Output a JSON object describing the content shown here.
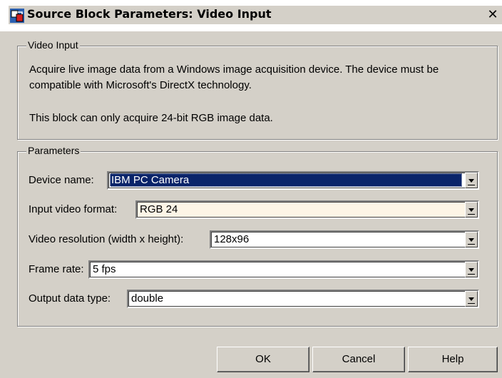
{
  "window": {
    "title": "Source Block Parameters: Video Input",
    "close_glyph": "✕",
    "icon": "simulink-block-icon"
  },
  "video_input_group": {
    "title": "Video Input",
    "description_1": "Acquire live image data from a Windows image acquisition device. The device must be compatible with Microsoft's DirectX technology.",
    "description_2": "This block can only acquire 24-bit RGB image data."
  },
  "parameters_group": {
    "title": "Parameters",
    "fields": {
      "device_name": {
        "label": "Device name:",
        "value": "IBM PC Camera"
      },
      "input_video_format": {
        "label": "Input video format:",
        "value": "RGB 24"
      },
      "video_resolution": {
        "label": "Video resolution (width x height):",
        "value": "128x96"
      },
      "frame_rate": {
        "label": "Frame rate:",
        "value": "5 fps"
      },
      "output_data_type": {
        "label": "Output data type:",
        "value": "double"
      }
    }
  },
  "buttons": {
    "ok": "OK",
    "cancel": "Cancel",
    "help": "Help"
  },
  "colors": {
    "dialog_bg": "#d4d0c8",
    "selection_bg": "#0a246a",
    "selection_fg": "#ffffff"
  }
}
